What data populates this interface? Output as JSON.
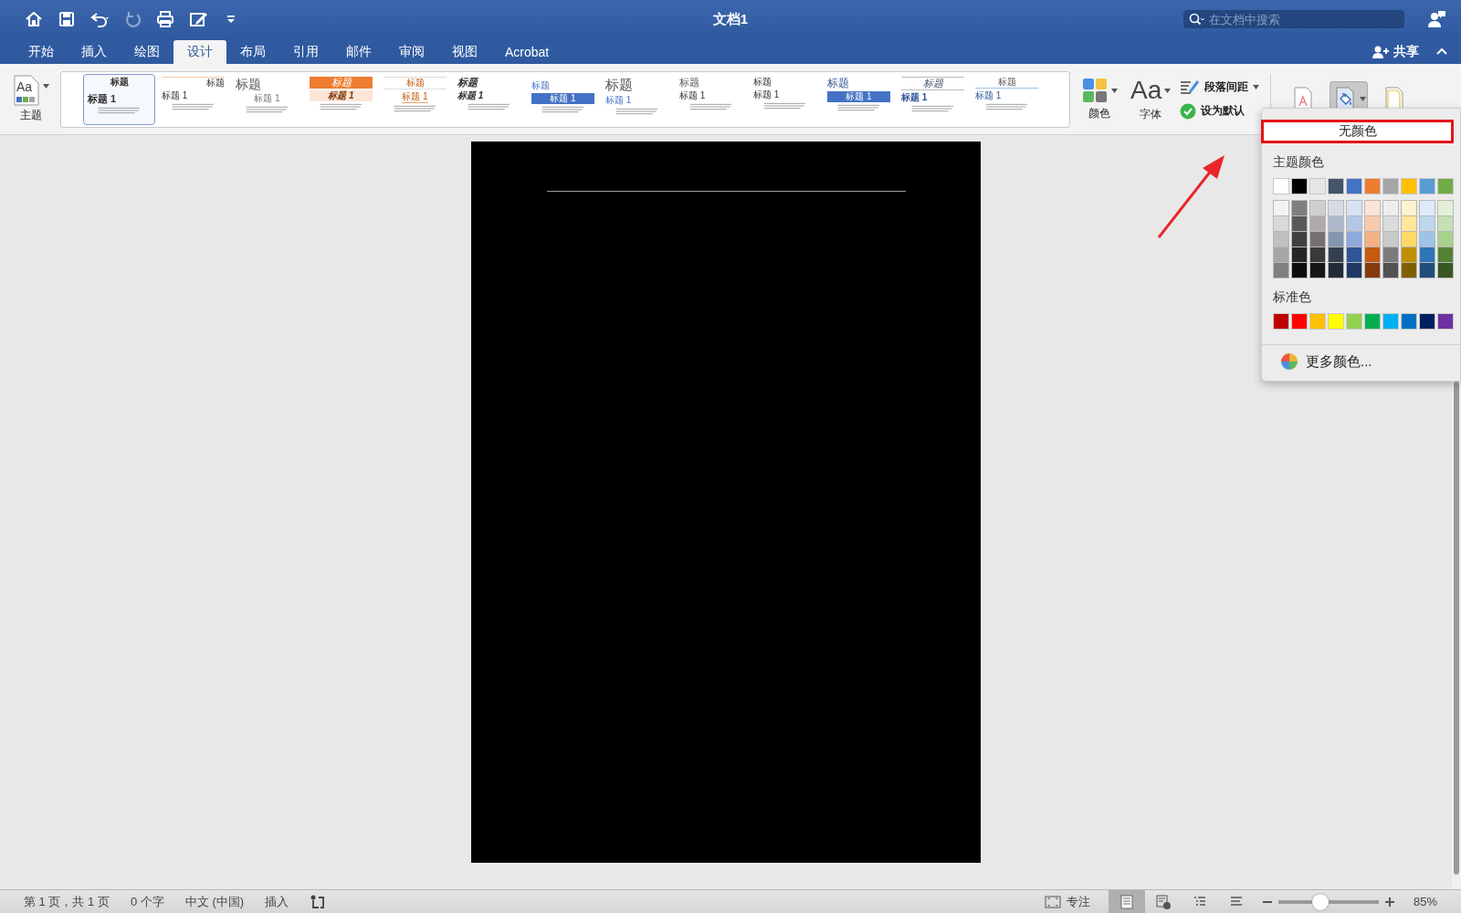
{
  "window": {
    "title": "文档1"
  },
  "quick_access": [
    {
      "kind": "home",
      "disabled": false
    },
    {
      "kind": "save",
      "disabled": false
    },
    {
      "kind": "undo",
      "disabled": false
    },
    {
      "kind": "redo",
      "disabled": true
    },
    {
      "kind": "print",
      "disabled": false
    },
    {
      "kind": "edit",
      "disabled": false
    },
    {
      "kind": "customize",
      "disabled": false
    }
  ],
  "search": {
    "placeholder": "在文档中搜索"
  },
  "share": {
    "label": "共享"
  },
  "tabs": [
    {
      "label": "开始",
      "selected": false
    },
    {
      "label": "插入",
      "selected": false
    },
    {
      "label": "绘图",
      "selected": false
    },
    {
      "label": "设计",
      "selected": true
    },
    {
      "label": "布局",
      "selected": false
    },
    {
      "label": "引用",
      "selected": false
    },
    {
      "label": "邮件",
      "selected": false
    },
    {
      "label": "审阅",
      "selected": false
    },
    {
      "label": "视图",
      "selected": false
    },
    {
      "label": "Acrobat",
      "selected": false
    }
  ],
  "ribbon": {
    "theme": {
      "label": "主题",
      "glyph": "Aa"
    },
    "gallery": [
      {
        "kind": "centered",
        "title": "标题",
        "heading": "标题 1",
        "selected": true
      },
      {
        "kind": "ruled",
        "title": "标题",
        "heading": "标题 1",
        "selected": false
      },
      {
        "kind": "large",
        "title": "标题",
        "heading": "标题 1",
        "selected": false
      },
      {
        "kind": "banner",
        "title": "标题",
        "heading": "标题 1",
        "selected": false
      },
      {
        "kind": "framed",
        "title": "标题",
        "heading": "标题 1",
        "selected": false
      },
      {
        "kind": "italic",
        "title": "标题",
        "heading": "标题 1",
        "selected": false
      },
      {
        "kind": "bar",
        "title": "标题",
        "heading": "标题 1",
        "selected": false
      },
      {
        "kind": "light",
        "title": "标题",
        "heading": "标题 1",
        "selected": false
      },
      {
        "kind": "simple",
        "title": "标题",
        "heading": "标题 1",
        "selected": false
      },
      {
        "kind": "compact",
        "title": "标题",
        "heading": "标题 1",
        "selected": false
      },
      {
        "kind": "barlarge",
        "title": "标题",
        "heading": "标题 1",
        "selected": false
      },
      {
        "kind": "elegant",
        "title": "标题",
        "heading": "标题 1",
        "selected": false
      },
      {
        "kind": "underline",
        "title": "标题",
        "heading": "标题 1",
        "selected": false
      }
    ],
    "colors": {
      "label": "颜色"
    },
    "fonts": {
      "label": "字体",
      "glyph": "Aa"
    },
    "paragraph_spacing": {
      "label": "段落间距"
    },
    "set_default": {
      "label": "设为默认"
    },
    "page_buttons": [
      {
        "kind": "watermark",
        "selected": false
      },
      {
        "kind": "color",
        "selected": true
      },
      {
        "kind": "borders",
        "selected": false
      }
    ]
  },
  "color_menu": {
    "no_color": "无颜色",
    "theme_title": "主题颜色",
    "theme_colors": [
      {
        "color": "#ffffff"
      },
      {
        "color": "#000000"
      },
      {
        "color": "#e7e6e6"
      },
      {
        "color": "#44546a"
      },
      {
        "color": "#4472c4"
      },
      {
        "color": "#ed7d31"
      },
      {
        "color": "#a5a5a5"
      },
      {
        "color": "#ffc000"
      },
      {
        "color": "#5b9bd5"
      },
      {
        "color": "#70ad47"
      }
    ],
    "tint_columns": [
      {
        "swatches": [
          {
            "color": "#f2f2f2"
          },
          {
            "color": "#d9d9d9"
          },
          {
            "color": "#bfbfbf"
          },
          {
            "color": "#a6a6a6"
          },
          {
            "color": "#808080"
          }
        ]
      },
      {
        "swatches": [
          {
            "color": "#7f7f7f"
          },
          {
            "color": "#595959"
          },
          {
            "color": "#404040"
          },
          {
            "color": "#262626"
          },
          {
            "color": "#0d0d0d"
          }
        ]
      },
      {
        "swatches": [
          {
            "color": "#d0cece"
          },
          {
            "color": "#aeaaaa"
          },
          {
            "color": "#767171"
          },
          {
            "color": "#3b3838"
          },
          {
            "color": "#171616"
          }
        ]
      },
      {
        "swatches": [
          {
            "color": "#d6dce5"
          },
          {
            "color": "#adb9ca"
          },
          {
            "color": "#8497b0"
          },
          {
            "color": "#333f50"
          },
          {
            "color": "#222a35"
          }
        ]
      },
      {
        "swatches": [
          {
            "color": "#d9e2f3"
          },
          {
            "color": "#b4c7e7"
          },
          {
            "color": "#8faadc"
          },
          {
            "color": "#2f5597"
          },
          {
            "color": "#1f3864"
          }
        ]
      },
      {
        "swatches": [
          {
            "color": "#fbe5d6"
          },
          {
            "color": "#f8cbad"
          },
          {
            "color": "#f4b183"
          },
          {
            "color": "#c55a11"
          },
          {
            "color": "#843c0c"
          }
        ]
      },
      {
        "swatches": [
          {
            "color": "#ededed"
          },
          {
            "color": "#dbdbdb"
          },
          {
            "color": "#c9c9c9"
          },
          {
            "color": "#7b7b7b"
          },
          {
            "color": "#525252"
          }
        ]
      },
      {
        "swatches": [
          {
            "color": "#fff2cc"
          },
          {
            "color": "#ffe699"
          },
          {
            "color": "#ffd966"
          },
          {
            "color": "#bf9000"
          },
          {
            "color": "#7f6000"
          }
        ]
      },
      {
        "swatches": [
          {
            "color": "#deebf7"
          },
          {
            "color": "#bdd7ee"
          },
          {
            "color": "#9dc3e6"
          },
          {
            "color": "#2e75b6"
          },
          {
            "color": "#1f4e79"
          }
        ]
      },
      {
        "swatches": [
          {
            "color": "#e2f0d9"
          },
          {
            "color": "#c5e0b4"
          },
          {
            "color": "#a9d18e"
          },
          {
            "color": "#548235"
          },
          {
            "color": "#385723"
          }
        ]
      }
    ],
    "standard_title": "标准色",
    "standard_colors": [
      {
        "color": "#c00000"
      },
      {
        "color": "#ff0000"
      },
      {
        "color": "#ffc000"
      },
      {
        "color": "#ffff00"
      },
      {
        "color": "#92d050"
      },
      {
        "color": "#00b050"
      },
      {
        "color": "#00b0f0"
      },
      {
        "color": "#0070c0"
      },
      {
        "color": "#002060"
      },
      {
        "color": "#7030a0"
      }
    ],
    "more": "更多颜色..."
  },
  "status_bar": {
    "page": "第 1 页，共 1 页",
    "words": "0 个字",
    "language": "中文 (中国)",
    "mode": "插入",
    "focus": "专注",
    "views": [
      {
        "kind": "print",
        "selected": true
      },
      {
        "kind": "web",
        "selected": false
      },
      {
        "kind": "outline",
        "selected": false
      },
      {
        "kind": "draft",
        "selected": false
      }
    ],
    "zoom": {
      "level": 0.42,
      "reading": "85%"
    }
  }
}
